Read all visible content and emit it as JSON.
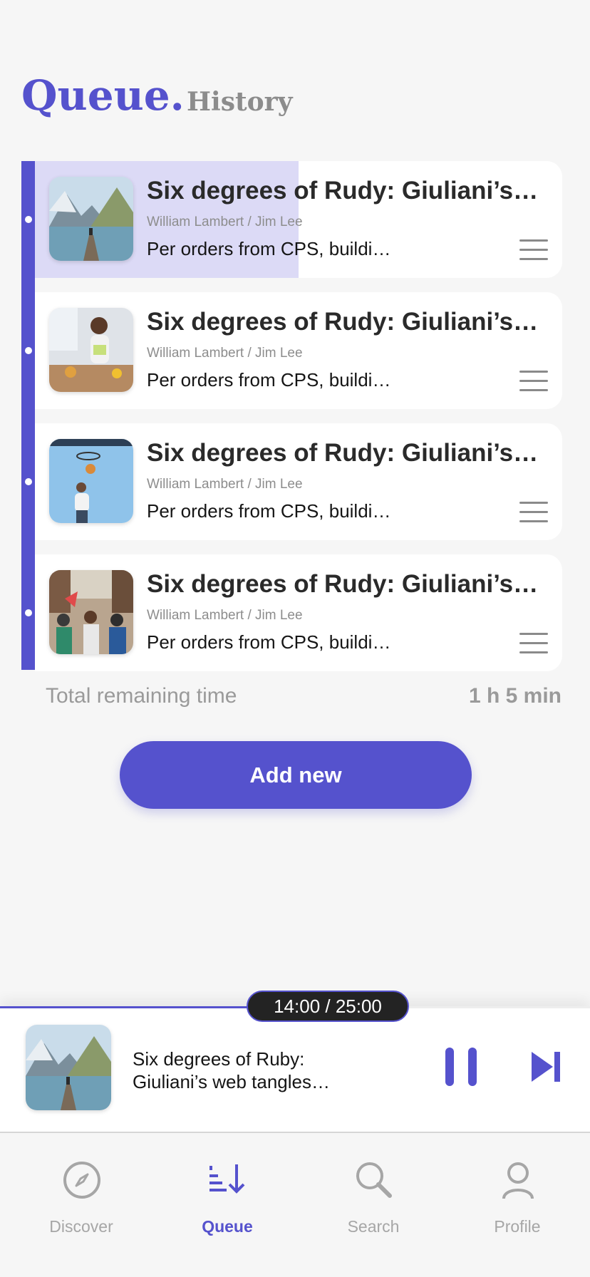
{
  "header": {
    "title": "Queue.",
    "tabs": [
      {
        "label": "Queue.",
        "active": true
      },
      {
        "label": "History",
        "active": false
      }
    ]
  },
  "queue": {
    "items": [
      {
        "title": "Six degrees of Rudy: Giuliani’s…",
        "authors": "William Lambert / Jim Lee",
        "description": "Per orders from CPS, buildi…",
        "thumbnail": "mountain-lake-dock",
        "play_progress": 0.5,
        "current": true
      },
      {
        "title": "Six degrees of Rudy: Giuliani’s…",
        "authors": "William Lambert / Jim Lee",
        "description": "Per orders from CPS, buildi…",
        "thumbnail": "woman-kitchen",
        "play_progress": 0,
        "current": false
      },
      {
        "title": "Six degrees of Rudy: Giuliani’s…",
        "authors": "William Lambert / Jim Lee",
        "description": "Per orders from CPS, buildi…",
        "thumbnail": "basketball-player",
        "play_progress": 0,
        "current": false
      },
      {
        "title": "Six degrees of Rudy: Giuliani’s…",
        "authors": "William Lambert / Jim Lee",
        "description": "Per orders from CPS, buildi…",
        "thumbnail": "street-crowd",
        "play_progress": 0,
        "current": false
      }
    ],
    "total_remaining_label": "Total remaining time",
    "total_remaining_value": "1 h 5 min",
    "add_button_label": "Add new"
  },
  "player": {
    "time_display": "14:00 / 25:00",
    "progress": 0.56,
    "title": "Six degrees of Ruby: Giuliani’s web tangles…",
    "thumbnail": "mountain-lake-dock",
    "pause_icon": "pause-icon",
    "next_icon": "skip-next-icon"
  },
  "nav": {
    "items": [
      {
        "label": "Discover",
        "icon": "compass-icon",
        "active": false
      },
      {
        "label": "Queue",
        "icon": "queue-sort-icon",
        "active": true
      },
      {
        "label": "Search",
        "icon": "search-icon",
        "active": false
      },
      {
        "label": "Profile",
        "icon": "profile-icon",
        "active": false
      }
    ]
  },
  "colors": {
    "accent": "#5552cd",
    "accent_light": "#dcdaf6",
    "background": "#f6f6f6",
    "muted": "#9a9a9a"
  }
}
